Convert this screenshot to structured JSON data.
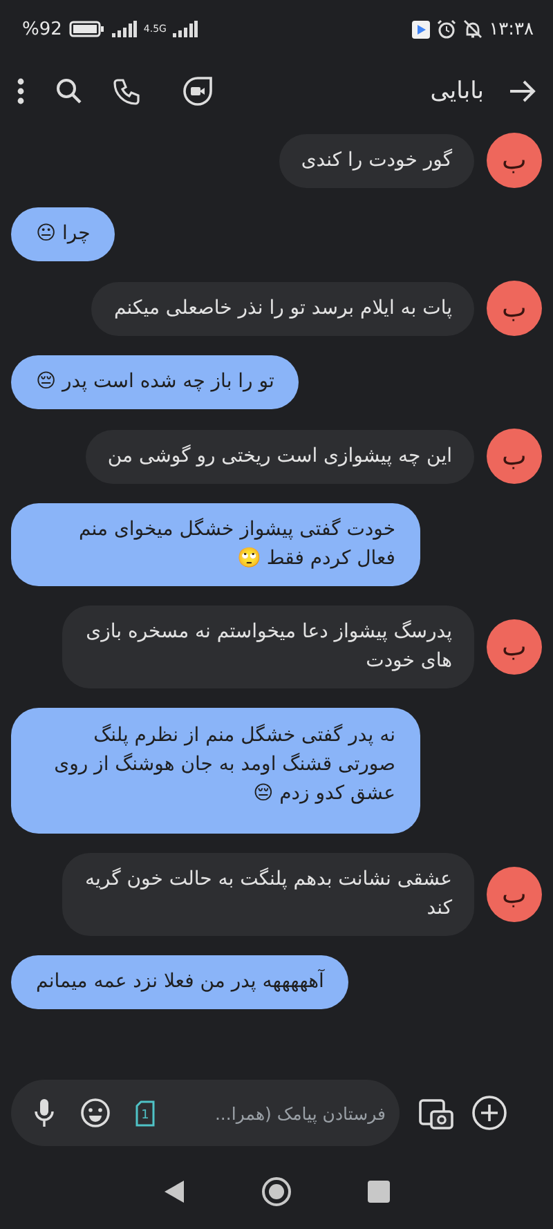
{
  "status_bar": {
    "time": "۱۳:۳۸",
    "battery": "%92",
    "network": "4.5G"
  },
  "header": {
    "title": "بابایی"
  },
  "messages": [
    {
      "kind": "incoming",
      "avatar": "ب",
      "text": "گور خودت را کندی"
    },
    {
      "kind": "outgoing",
      "text": "چرا 😐"
    },
    {
      "kind": "incoming",
      "avatar": "ب",
      "text": "پات به ایلام برسد تو را نذر خاصعلی میکنم"
    },
    {
      "kind": "outgoing",
      "text": "تو را  باز چه شده است پدر 😔"
    },
    {
      "kind": "incoming",
      "avatar": "ب",
      "text": "این چه پیشوازی است ریختی رو گوشی من"
    },
    {
      "kind": "outgoing",
      "text": "خودت گفتی پیشواز خشگل میخوای منم فعال کردم فقط 🙄"
    },
    {
      "kind": "incoming",
      "avatar": "ب",
      "text": "پدرسگ پیشواز دعا میخواستم نه مسخره بازی های خودت"
    },
    {
      "kind": "outgoing",
      "text": "نه پدر گفتی خشگل منم از نظرم پلنگ صورتی قشنگ اومد به جان هوشنگ از روی عشق کدو زدم 😔"
    },
    {
      "kind": "incoming",
      "avatar": "ب",
      "text": "عشقی نشانت بدهم پلنگت به حالت خون گریه کند"
    },
    {
      "kind": "outgoing",
      "text": "آهههههه پدر من فعلا نزد عمه میمانم"
    }
  ],
  "composer": {
    "placeholder": "فرستادن پیامک (همرا...",
    "sim": "1"
  }
}
